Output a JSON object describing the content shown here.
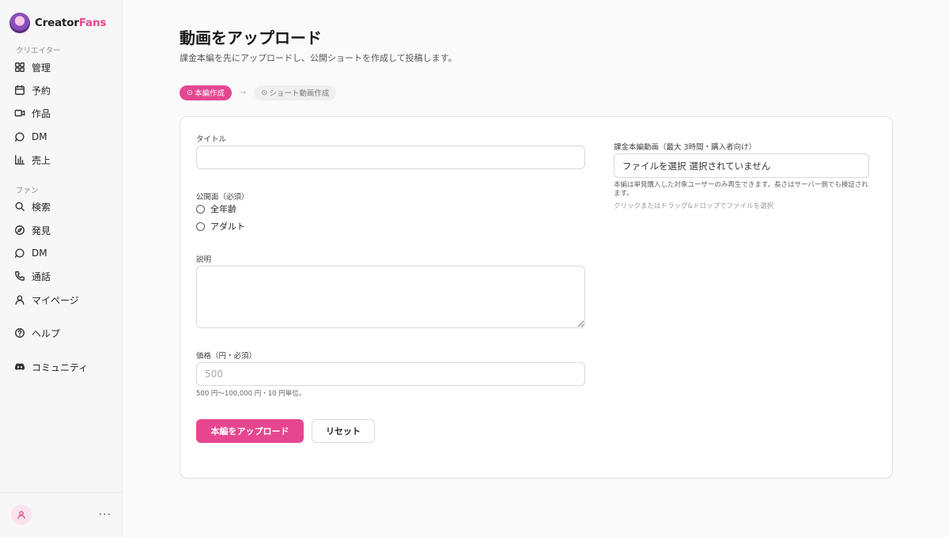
{
  "brand": {
    "name_part1": "Creator",
    "name_part2": "Fans"
  },
  "sidebar": {
    "creator_label": "クリエイター",
    "creator_items": [
      {
        "label": "管理",
        "icon": "grid-icon"
      },
      {
        "label": "予約",
        "icon": "calendar-icon"
      },
      {
        "label": "作品",
        "icon": "video-icon"
      },
      {
        "label": "DM",
        "icon": "chat-icon"
      },
      {
        "label": "売上",
        "icon": "bar-chart-icon"
      }
    ],
    "fan_label": "ファン",
    "fan_items": [
      {
        "label": "検索",
        "icon": "search-icon"
      },
      {
        "label": "発見",
        "icon": "compass-icon"
      },
      {
        "label": "DM",
        "icon": "chat-icon"
      },
      {
        "label": "通話",
        "icon": "phone-icon"
      },
      {
        "label": "マイページ",
        "icon": "user-icon"
      }
    ],
    "help_label": "ヘルプ",
    "community_label": "コミュニティ",
    "more": "···"
  },
  "page": {
    "title": "動画をアップロード",
    "subtitle": "課金本編を先にアップロードし、公開ショートを作成して投稿します。"
  },
  "steps": [
    {
      "icon": "⊙",
      "label": "本編作成"
    },
    {
      "icon": "⊙",
      "label": "ショート動画作成"
    }
  ],
  "form": {
    "title_label": "タイトル",
    "title_value": "",
    "audience_label": "公開面（必須）",
    "audience_options": [
      "全年齢",
      "アダルト"
    ],
    "description_label": "説明",
    "description_value": "",
    "price_label": "価格（円・必須）",
    "price_placeholder": "500",
    "price_hint": "500 円〜100,000 円・10 円単位。",
    "submit_label": "本編をアップロード",
    "reset_label": "リセット",
    "video_label": "課金本編動画（最大 3時間・購入者向け）",
    "file_button": "ファイルを選択",
    "file_status": "選択されていません",
    "video_hint": "本編は単発購入した対象ユーザーのみ再生できます。長さはサーバー側でも検証されます。",
    "drop_hint": "クリックまたはドラッグ&ドロップでファイルを選択"
  },
  "colors": {
    "accent": "#e64690",
    "background": "#fafafa",
    "sidebar": "#f7f7f7"
  }
}
